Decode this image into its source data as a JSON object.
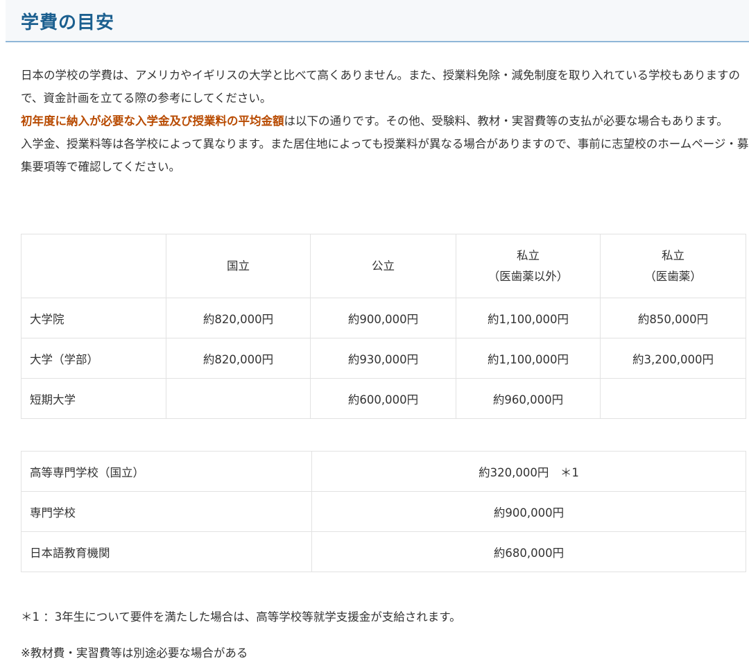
{
  "page_title": "学費の目安",
  "intro": {
    "p1": "日本の学校の学費は、アメリカやイギリスの大学と比べて高くありません。また、授業料免除・減免制度を取り入れている学校もありますので、資金計画を立てる際の参考にしてください。",
    "p2_highlight": "初年度に納入が必要な入学金及び授業料の平均金額",
    "p2_rest": "は以下の通りです。その他、受験料、教材・実習費等の支払が必要な場合もあります。",
    "p3": "入学金、授業料等は各学校によって異なります。また居住地によっても授業料が異なる場合がありますので、事前に志望校のホームページ・募集要項等で確認してください。"
  },
  "fees_table": {
    "headers": [
      {
        "line1": "",
        "line2": ""
      },
      {
        "line1": "国立",
        "line2": ""
      },
      {
        "line1": "公立",
        "line2": ""
      },
      {
        "line1": "私立",
        "line2": "（医歯薬以外）"
      },
      {
        "line1": "私立",
        "line2": "（医歯薬）"
      }
    ],
    "rows": [
      {
        "label": "大学院",
        "values": [
          "約820,000円",
          "約900,000円",
          "約1,100,000円",
          "約850,000円"
        ]
      },
      {
        "label": "大学（学部）",
        "values": [
          "約820,000円",
          "約930,000円",
          "約1,100,000円",
          "約3,200,000円"
        ]
      },
      {
        "label": "短期大学",
        "values": [
          "",
          "約600,000円",
          "約960,000円",
          ""
        ]
      }
    ]
  },
  "other_table": {
    "rows": [
      {
        "label": "高等専門学校（国立）",
        "value": "約320,000円　＊1"
      },
      {
        "label": "専門学校",
        "value": "約900,000円"
      },
      {
        "label": "日本語教育機関",
        "value": "約680,000円"
      }
    ]
  },
  "notes": {
    "note1": "＊1 ：3年生について要件を満たした場合は、高等学校等就学支援金が支給されます。",
    "note2": "※教材費・実習費等は別途必要な場合がある"
  },
  "colors": {
    "title": "#1b5f8f",
    "highlight": "#b84a00",
    "header_rule": "#8fb6d8",
    "table_border": "#e2e2e2"
  }
}
